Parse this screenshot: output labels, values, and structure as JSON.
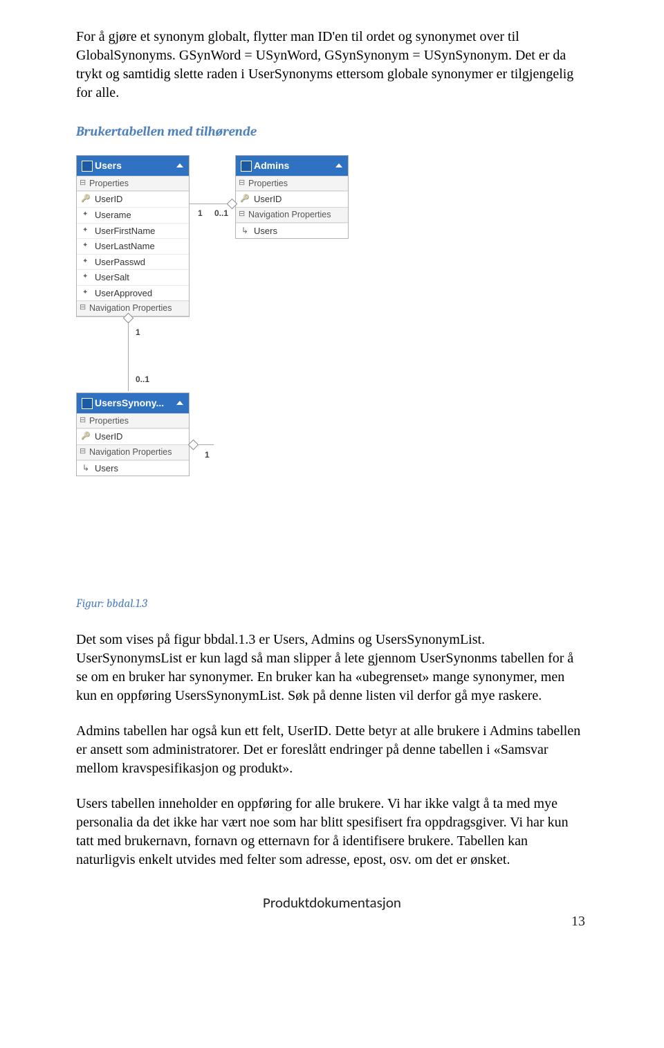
{
  "paragraphs": {
    "p1": "For å gjøre et synonym globalt, flytter man ID'en til ordet og synonymet over til GlobalSynonyms. GSynWord = USynWord, GSynSynonym = USynSynonym. Det er da trykt og samtidig slette raden i UserSynonyms ettersom globale synonymer er tilgjengelig for alle.",
    "p2": "Det som vises på figur bbdal.1.3 er Users, Admins og UsersSynonymList. UserSynonymsList er kun lagd så man slipper å lete gjennom UserSynonms tabellen for å se om en bruker har synonymer. En bruker kan ha «ubegrenset» mange synonymer, men kun en oppføring UsersSynonymList. Søk på denne listen vil derfor gå mye raskere.",
    "p3": "Admins tabellen har også kun ett felt, UserID. Dette betyr at alle brukere i Admins tabellen er ansett som administratorer. Det er foreslått endringer på denne tabellen i «Samsvar mellom kravspesifikasjon og produkt».",
    "p4": "Users tabellen inneholder en oppføring for alle brukere. Vi har ikke valgt å ta med mye personalia da det ikke har vært noe som har blitt spesifisert fra oppdragsgiver. Vi har kun tatt med brukernavn, fornavn og etternavn for å identifisere brukere. Tabellen kan naturligvis enkelt utvides med felter som adresse, epost, osv. om det er ønsket."
  },
  "headings": {
    "section": "Brukertabellen med tilhørende",
    "caption": "Figur: bbdal.1.3"
  },
  "entities": {
    "users": {
      "title": "Users",
      "groups": {
        "props": "Properties",
        "nav": "Navigation Properties"
      },
      "fields": [
        "UserID",
        "Userame",
        "UserFirstName",
        "UserLastName",
        "UserPasswd",
        "UserSalt",
        "UserApproved"
      ]
    },
    "admins": {
      "title": "Admins",
      "groups": {
        "props": "Properties",
        "nav": "Navigation Properties"
      },
      "fields": [
        "UserID"
      ],
      "navFields": [
        "Users"
      ]
    },
    "usersyn": {
      "title": "UsersSynony...",
      "groups": {
        "props": "Properties",
        "nav": "Navigation Properties"
      },
      "fields": [
        "UserID"
      ],
      "navFields": [
        "Users"
      ]
    }
  },
  "multiplicities": {
    "usersAdmins": {
      "left": "1",
      "right": "0..1"
    },
    "usersSyn": {
      "top": "1",
      "bottom": "0..1",
      "synRight": "1"
    }
  },
  "footer": {
    "title": "Produktdokumentasjon",
    "page": "13"
  }
}
